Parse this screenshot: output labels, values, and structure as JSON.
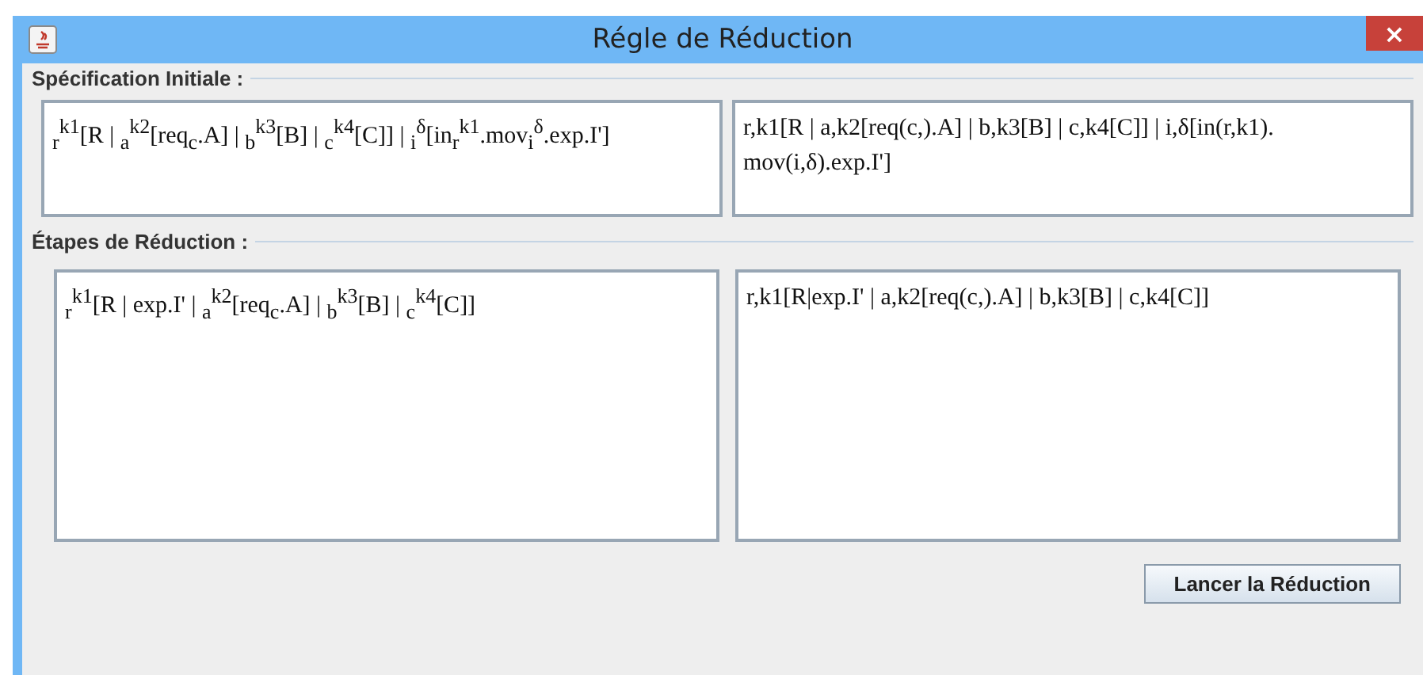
{
  "window": {
    "title": "Régle de Réduction",
    "close": "×"
  },
  "specification": {
    "title": "Spécification Initiale :",
    "notation": "$_{r}$$^{k1}$[R | $_{a}$$^{k2}$[req$_{c}$.A] | $_{b}$$^{k3}$[B] | $_{c}$$^{k4}$[C]] | $_{i}$$^{δ}$[in$_{r}$$^{k1}$.mov$_{i}$$^{δ}$.exp.I']",
    "linear": "r,k1[R | a,k2[req(c,).A] | b,k3[B] | c,k4[C]] | i,δ[in(r,k1). mov(i,δ).exp.I']"
  },
  "steps": {
    "title": "Étapes de Réduction :",
    "notation": "$_{r}$$^{k1}$[R | exp.I' | $_{a}$$^{k2}$[req$_{c}$.A] | $_{b}$$^{k3}$[B] | $_{c}$$^{k4}$[C]]",
    "linear": "r,k1[R|exp.I' | a,k2[req(c,).A] | b,k3[B] | c,k4[C]]"
  },
  "button": "Lancer la Réduction"
}
